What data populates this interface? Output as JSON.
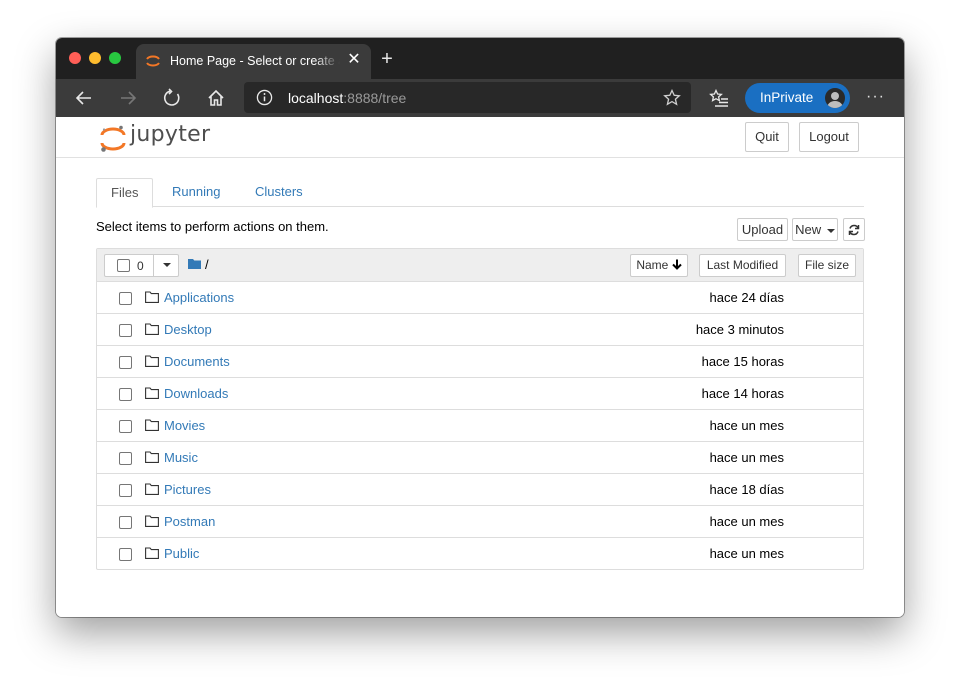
{
  "browser": {
    "tab_title": "Home Page - Select or create a notebook",
    "address_host": "localhost",
    "address_rest": ":8888/tree",
    "inprivate_label": "InPrivate",
    "more_label": "···"
  },
  "header": {
    "logo_text": "jupyter",
    "quit_label": "Quit",
    "logout_label": "Logout"
  },
  "tabs": [
    {
      "label": "Files"
    },
    {
      "label": "Running"
    },
    {
      "label": "Clusters"
    }
  ],
  "toolbar": {
    "hint": "Select items to perform actions on them.",
    "upload_label": "Upload",
    "new_label": "New"
  },
  "list_header": {
    "selected_count": "0",
    "breadcrumb": "/",
    "sort_name_label": "Name",
    "sort_modified_label": "Last Modified",
    "sort_size_label": "File size"
  },
  "items": [
    {
      "name": "Applications",
      "modified": "hace 24 días"
    },
    {
      "name": "Desktop",
      "modified": "hace 3 minutos"
    },
    {
      "name": "Documents",
      "modified": "hace 15 horas"
    },
    {
      "name": "Downloads",
      "modified": "hace 14 horas"
    },
    {
      "name": "Movies",
      "modified": "hace un mes"
    },
    {
      "name": "Music",
      "modified": "hace un mes"
    },
    {
      "name": "Pictures",
      "modified": "hace 18 días"
    },
    {
      "name": "Postman",
      "modified": "hace un mes"
    },
    {
      "name": "Public",
      "modified": "hace un mes"
    }
  ],
  "colors": {
    "link": "#337ab7",
    "inprivate": "#1a6fc2",
    "jupyter_orange": "#f37726"
  }
}
